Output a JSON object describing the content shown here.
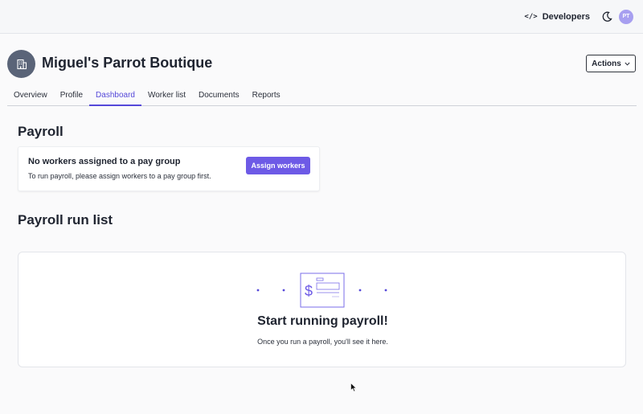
{
  "topbar": {
    "developers_label": "Developers",
    "avatar_initials": "PT"
  },
  "header": {
    "company_name": "Miguel's Parrot Boutique",
    "actions_label": "Actions"
  },
  "tabs": [
    {
      "label": "Overview",
      "active": false
    },
    {
      "label": "Profile",
      "active": false
    },
    {
      "label": "Dashboard",
      "active": true
    },
    {
      "label": "Worker list",
      "active": false
    },
    {
      "label": "Documents",
      "active": false
    },
    {
      "label": "Reports",
      "active": false
    }
  ],
  "payroll": {
    "title": "Payroll",
    "card_title": "No workers assigned to a pay group",
    "card_desc": "To run payroll, please assign workers to a pay group first.",
    "assign_button": "Assign workers"
  },
  "run_list": {
    "title": "Payroll run list",
    "empty_title": "Start running payroll!",
    "empty_desc": "Once you run a payroll, you'll see it here.",
    "illustration_symbol": "$"
  },
  "colors": {
    "accent": "#6d5ae6",
    "tab_active": "#5548d9",
    "avatar": "#a79ff0",
    "logo": "#5a6478"
  },
  "icons": {
    "developers": "code-icon",
    "theme": "moon-icon",
    "company": "building-icon",
    "actions": "chevron-down-icon"
  }
}
